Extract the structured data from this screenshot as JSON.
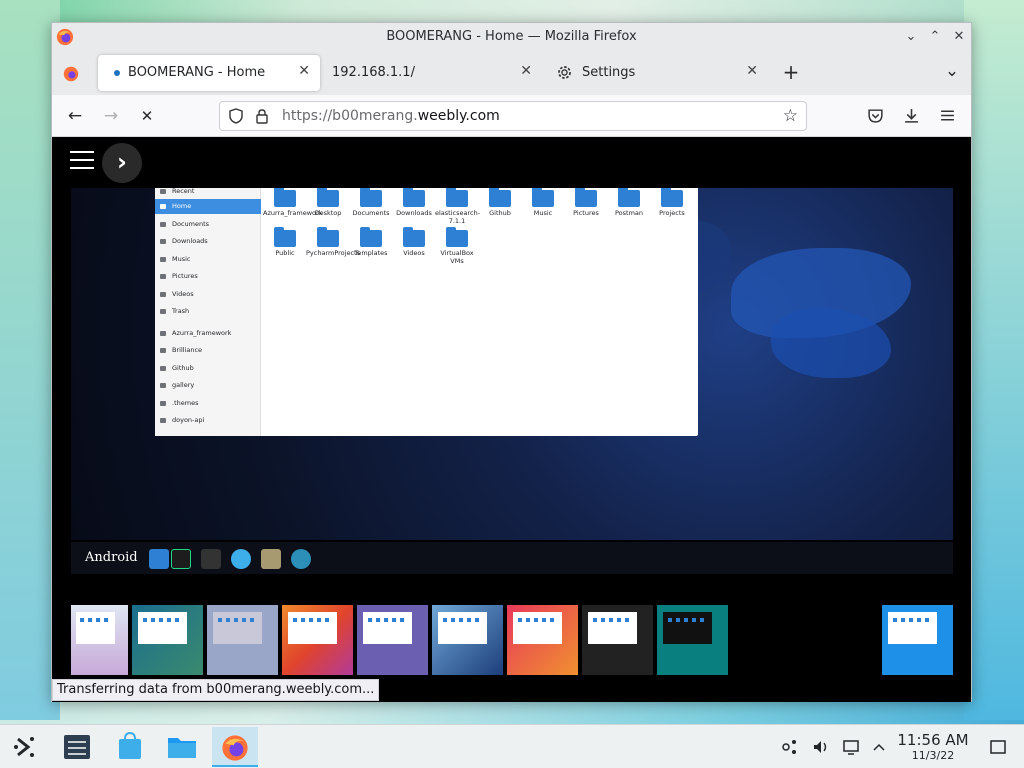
{
  "window": {
    "title": "BOOMERANG - Home — Mozilla Firefox",
    "controls": {
      "minimize": "⌄",
      "maximize": "⌃",
      "close": "✕"
    }
  },
  "tabs": [
    {
      "label": "BOOMERANG - Home",
      "close": "✕",
      "active": true
    },
    {
      "label": "192.168.1.1/",
      "close": "✕",
      "active": false
    },
    {
      "label": "Settings",
      "close": "✕",
      "active": false
    }
  ],
  "tabbar": {
    "new_tab": "+",
    "list_all": "⌄"
  },
  "navbar": {
    "back": "←",
    "forward": "→",
    "stop": "✕",
    "url_prefix": "https://b00merang.",
    "url_domain": "weebly.com",
    "bookmark": "☆"
  },
  "page": {
    "dock_label": "Android",
    "file_manager": {
      "sidebar": [
        "Recent",
        "Home",
        "Documents",
        "Downloads",
        "Music",
        "Pictures",
        "Videos",
        "Trash",
        "Azurra_framework",
        "Brilliance",
        "Github",
        "gallery",
        ".themes",
        "doyon-api"
      ],
      "selected": "Home",
      "folders_row1": [
        "Azurra_framework",
        "Desktop",
        "Documents",
        "Downloads",
        "elasticsearch-7.1.1",
        "Github",
        "Music",
        "Pictures",
        "Postman",
        "Projects"
      ],
      "folders_row2": [
        "Public",
        "PycharmProjects",
        "Templates",
        "Videos",
        "VirtualBox VMs"
      ]
    },
    "status": "Transferring data from b00merang.weebly.com..."
  },
  "taskbar": {
    "clock_time": "11:56 AM",
    "clock_date": "11/3/22"
  },
  "colors": {
    "accent": "#3daee9",
    "page_bg": "#000000",
    "folder_blue": "#2e80d4"
  }
}
